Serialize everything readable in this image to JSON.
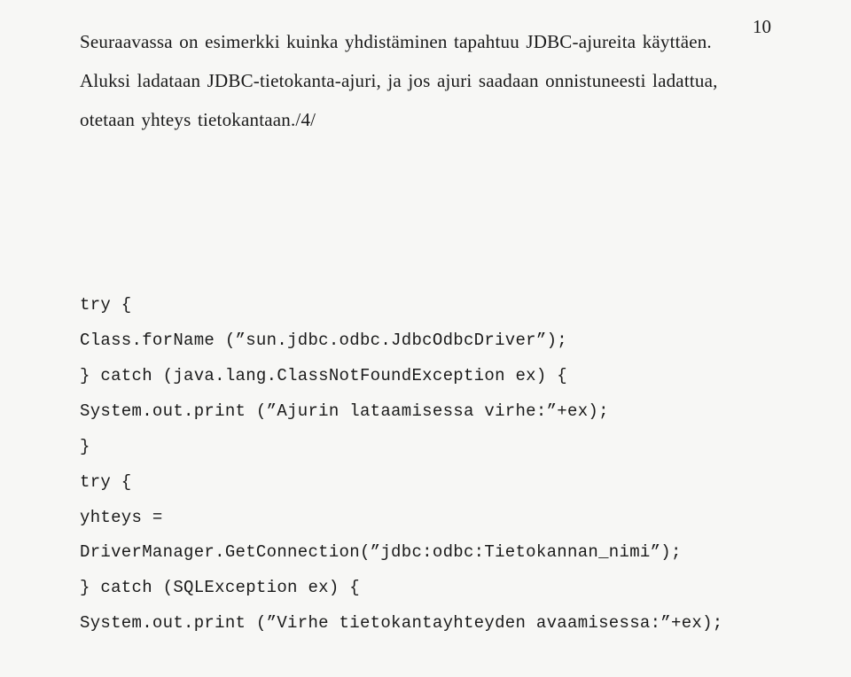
{
  "pageNumber": "10",
  "paragraph": {
    "l1": "Seuraavassa on esimerkki kuinka yhdistäminen tapahtuu JDBC-ajureita käyttäen.",
    "l2": "Aluksi ladataan JDBC-tietokanta-ajuri, ja jos ajuri saadaan onnistuneesti ladattua,",
    "l3": "otetaan yhteys tietokantaan./4/"
  },
  "code": {
    "c1": "try {",
    "c2": "Class.forName (”sun.jdbc.odbc.JdbcOdbcDriver”);",
    "c3": "} catch (java.lang.ClassNotFoundException ex) {",
    "c4": "System.out.print (”Ajurin lataamisessa virhe:”+ex);",
    "c5": "}",
    "c6": "try {",
    "c7": "yhteys =",
    "c8": "DriverManager.GetConnection(”jdbc:odbc:Tietokannan_nimi”);",
    "c9": "} catch (SQLException ex) {",
    "c10": "System.out.print (”Virhe tietokantayhteyden avaamisessa:”+ex);"
  }
}
